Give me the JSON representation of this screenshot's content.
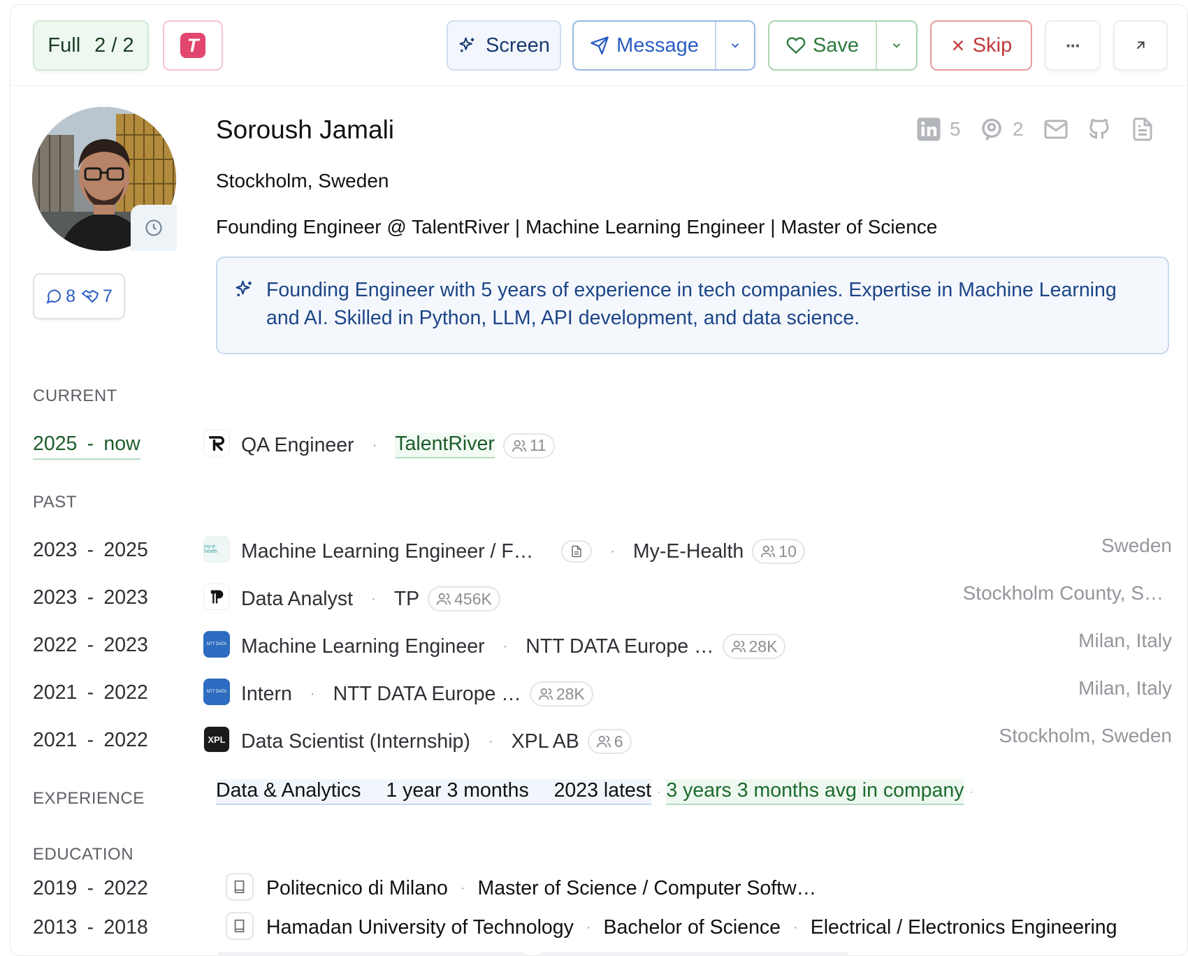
{
  "toolbar": {
    "full_label": "Full",
    "full_count": "2 / 2",
    "t_badge": "T",
    "screen_label": "Screen",
    "message_label": "Message",
    "save_label": "Save",
    "skip_label": "Skip",
    "more_label": "···",
    "open_label": "↗"
  },
  "profile": {
    "name": "Soroush Jamali",
    "location": "Stockholm, Sweden",
    "headline": "Founding Engineer @ TalentRiver | Machine Learning Engineer | Master of Science",
    "summary": "Founding Engineer with 5 years of experience in tech companies. Expertise in Machine Learning and AI. Skilled in Python, LLM, API development, and data science.",
    "counts": {
      "messages": "8",
      "deals": "7"
    },
    "social": {
      "linkedin_count": "5",
      "reviews_count": "2"
    }
  },
  "sections": {
    "current": "CURRENT",
    "past": "PAST",
    "experience": "EXPERIENCE",
    "education": "EDUCATION"
  },
  "current": [
    {
      "start": "2025",
      "end": "now",
      "title": "QA Engineer",
      "company": "TalentRiver",
      "size": "11",
      "location": ""
    }
  ],
  "past": [
    {
      "start": "2023",
      "end": "2025",
      "title": "Machine Learning Engineer / F…",
      "company": "My-E-Health",
      "size": "10",
      "location": "Sweden",
      "logo": "myehealth"
    },
    {
      "start": "2023",
      "end": "2023",
      "title": "Data Analyst",
      "company": "TP",
      "size": "456K",
      "location": "Stockholm County, S…",
      "logo": "tp"
    },
    {
      "start": "2022",
      "end": "2023",
      "title": "Machine Learning Engineer",
      "company": "NTT DATA Europe …",
      "size": "28K",
      "location": "Milan, Italy",
      "logo": "ntt"
    },
    {
      "start": "2021",
      "end": "2022",
      "title": "Intern",
      "company": "NTT DATA Europe …",
      "size": "28K",
      "location": "Milan, Italy",
      "logo": "ntt"
    },
    {
      "start": "2021",
      "end": "2022",
      "title": "Data Scientist (Internship)",
      "company": "XPL AB",
      "size": "6",
      "location": "Stockholm, Sweden",
      "logo": "xpl"
    }
  ],
  "experience": {
    "area": "Data & Analytics",
    "duration": "1 year 3 months",
    "latest": "2023 latest",
    "avg": "3 years 3 months avg in company"
  },
  "education": [
    {
      "start": "2019",
      "end": "2022",
      "school": "Politecnico di Milano",
      "degree": "Master of Science / Computer Softw…",
      "field": ""
    },
    {
      "start": "2013",
      "end": "2018",
      "school": "Hamadan University of Technology",
      "degree": "Bachelor of Science",
      "field": "Electrical / Electronics Engineering"
    }
  ],
  "logos": {
    "myehealth_text": "my-e-health",
    "ntt_text": "NTT DATA",
    "xpl_text": "XPL"
  },
  "colors": {
    "accent_blue": "#2a5dc3",
    "accent_green": "#2c7a3d",
    "accent_red": "#c23a3a",
    "brand_pink": "#e2456d"
  }
}
